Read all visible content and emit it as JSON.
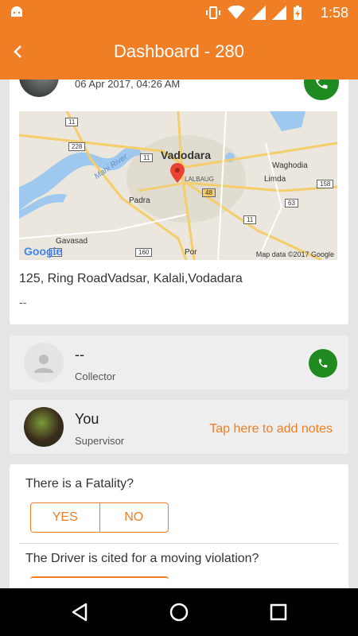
{
  "status_bar": {
    "time": "1:58",
    "icons": [
      "android-icon",
      "vibrate-icon",
      "wifi-icon",
      "signal-icon",
      "signal-icon",
      "battery-charging-icon"
    ]
  },
  "app_bar": {
    "title": "Dashboard - 280",
    "back_icon": "back-arrow-icon"
  },
  "incident": {
    "name_partial": "····· ·······",
    "date": "06 Apr 2017, 04:26 AM",
    "map": {
      "city": "Vadodara",
      "labels": [
        "LALBAUG",
        "Mahi River",
        "Waghodia",
        "Limda",
        "Padra",
        "Gavasad",
        "Por"
      ],
      "roads": [
        "11",
        "228",
        "11",
        "48",
        "158",
        "63",
        "11",
        "160",
        "11"
      ],
      "brand": "Google",
      "attribution": "Map data ©2017 Google"
    },
    "address": "125, Ring RoadVadsar, Kalali,Vodadara",
    "extra": "--"
  },
  "collector": {
    "name": "--",
    "role": "Collector"
  },
  "supervisor": {
    "name": "You",
    "role": "Supervisor",
    "notes_link": "Tap here to add notes"
  },
  "questions": [
    {
      "text": "There is a Fatality?",
      "yes": "YES",
      "no": "NO"
    },
    {
      "text": "The Driver is cited for a moving violation?"
    }
  ],
  "colors": {
    "accent": "#f07e25",
    "call_green": "#1f8a1f",
    "background": "#e5e5e5"
  }
}
